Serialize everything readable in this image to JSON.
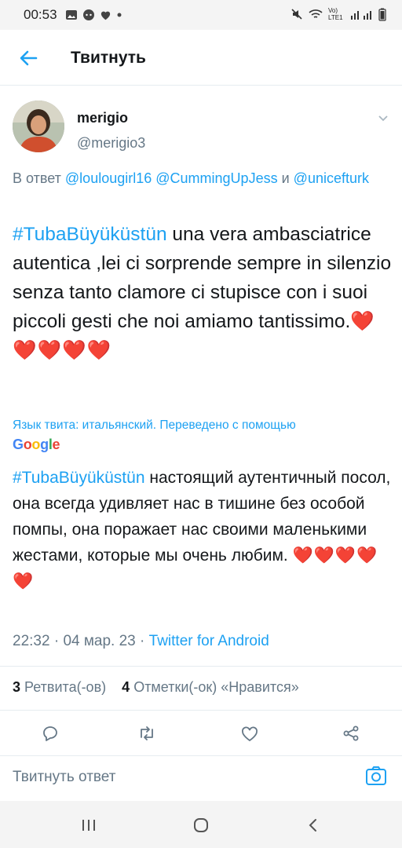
{
  "status_bar": {
    "time": "00:53",
    "network": "Vo) LTE1"
  },
  "app_bar": {
    "title": "Твитнуть",
    "back_icon": "back-arrow-icon"
  },
  "tweet": {
    "author_name": "merigio",
    "author_handle": "@merigio3",
    "reply_prefix": "В ответ",
    "reply_mention_1": "@loulougirl16",
    "reply_mention_2": "@CummingUpJess",
    "reply_and": "и",
    "reply_mention_3": "@unicefturk",
    "hashtag": "#TubaBüyüküstün",
    "text": " una vera ambasciatrice autentica ,lei ci sorprende sempre in silenzio senza tanto clamore ci stupisce con i suoi piccoli gesti che noi amiamo tantissimo.",
    "hearts": "❤️❤️❤️❤️❤️",
    "language_note": "Язык твита: итальянский. Переведено с помощью",
    "translation_hashtag": "#TubaBüyüküstün",
    "translation_text": " настоящий аутентичный посол, она всегда удивляет нас в тишине без особой помпы, она поражает нас своими маленькими жестами, которые мы очень любим. ",
    "translation_hearts": "❤️❤️❤️❤️❤️",
    "time": "22:32",
    "date": "04 мар. 23",
    "source": "Twitter for Android",
    "meta_separator": " · "
  },
  "stats": {
    "retweets_count": "3",
    "retweets_label": "Ретвита(-ов)",
    "likes_count": "4",
    "likes_label": "Отметки(-ок) «Нравится»"
  },
  "reply_bar": {
    "placeholder": "Твитнуть ответ"
  },
  "colors": {
    "accent": "#1da1f2",
    "secondary_text": "#657786",
    "heart": "#e0245e",
    "divider": "#e6ecf0"
  },
  "google_logo": [
    "G",
    "o",
    "o",
    "g",
    "l",
    "e"
  ]
}
